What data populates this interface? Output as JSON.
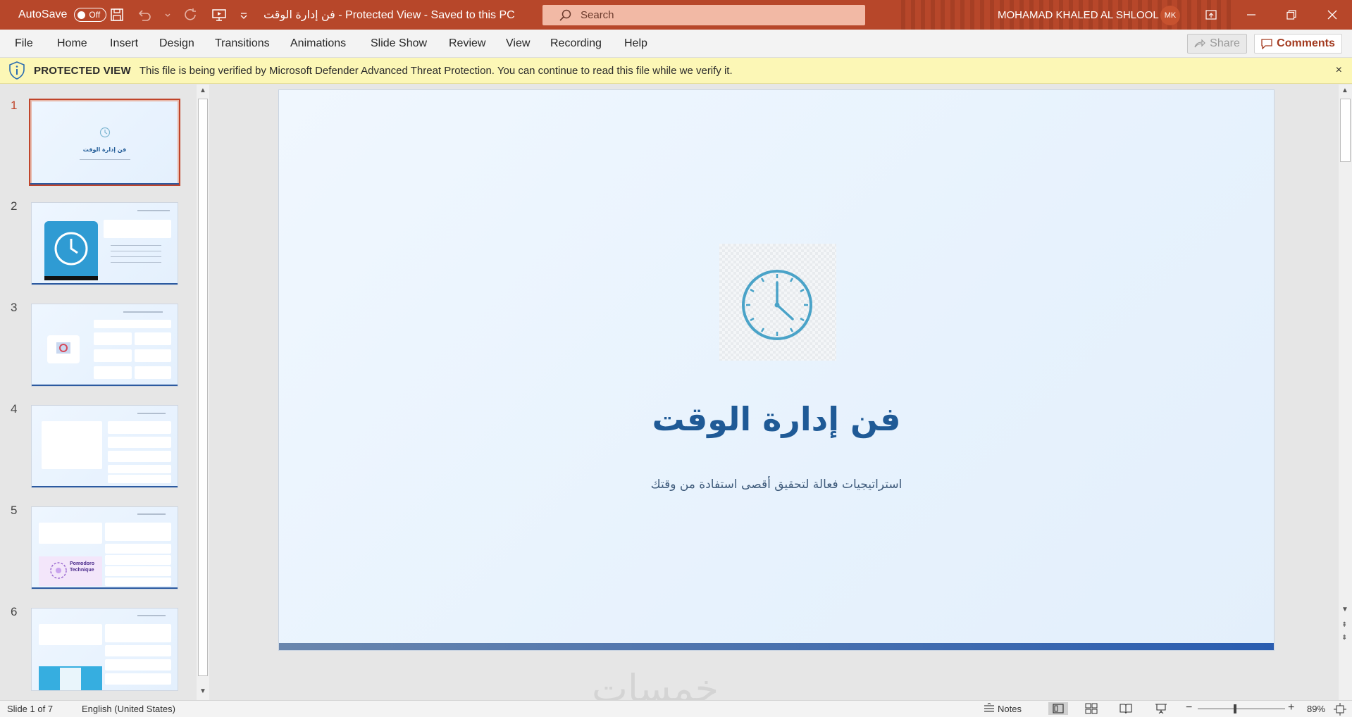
{
  "titlebar": {
    "autosave_label": "AutoSave",
    "autosave_state": "Off",
    "doc_title": "فن إدارة الوقت  -  Protected View  -  Saved to this PC",
    "search_placeholder": "Search",
    "user_name": "MOHAMAD KHALED AL SHLOOL",
    "avatar_initials": "MK"
  },
  "ribbon": {
    "tabs": [
      "File",
      "Home",
      "Insert",
      "Design",
      "Transitions",
      "Animations",
      "Slide Show",
      "Review",
      "View",
      "Recording",
      "Help"
    ],
    "share_label": "Share",
    "comments_label": "Comments"
  },
  "message_bar": {
    "label": "PROTECTED VIEW",
    "text": "This file is being verified by Microsoft Defender Advanced Threat Protection. You can continue to read this file while we verify it.",
    "close": "×"
  },
  "thumbnails": {
    "numbers": [
      "1",
      "2",
      "3",
      "4",
      "5",
      "6"
    ],
    "slide1_title": "فن إدارة الوقت",
    "slide5_title": "Pomodoro Technique"
  },
  "slide": {
    "title": "فن إدارة الوقت",
    "subtitle": "استراتيجيات فعالة لتحقيق أقصى استفادة من وقتك"
  },
  "watermark": "خمسات",
  "statusbar": {
    "slide_counter": "Slide 1 of 7",
    "language": "English (United States)",
    "notes_label": "Notes",
    "zoom_minus": "−",
    "zoom_plus": "+",
    "zoom_level": "89%"
  },
  "colors": {
    "titlebar": "#b7472a",
    "accent": "#c0442a",
    "slide_title": "#1f5a96",
    "clock": "#4aa3c8"
  }
}
